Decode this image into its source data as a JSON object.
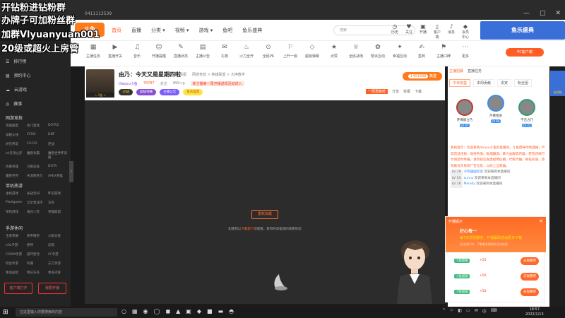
{
  "window": {
    "url": "0411113539",
    "minimize": "—",
    "maximize": "▢",
    "close": "✕"
  },
  "overlay": {
    "line1": "开钻粉进钻粉群",
    "line2": "办牌子可加粉丝群",
    "line3": "加群Vlyuanyuan001",
    "line4": "20级或超火上房管"
  },
  "nav": {
    "logo": "斗鱼",
    "items": [
      "首页",
      "直播",
      "分类 ▾",
      "视频 ▾",
      "游戏 ▾",
      "鱼吧",
      "鱼乐盛典"
    ],
    "search_placeholder": "搜索",
    "icons": [
      {
        "icon": "history-icon",
        "glyph": "◷",
        "label": "历史"
      },
      {
        "icon": "follow-icon",
        "glyph": "♥",
        "label": "关注"
      },
      {
        "icon": "broadcast-icon",
        "glyph": "▣",
        "label": "开播"
      },
      {
        "icon": "mobile-icon",
        "glyph": "▯",
        "label": "客户端"
      },
      {
        "icon": "bell-icon",
        "glyph": "♪",
        "label": "消息"
      },
      {
        "icon": "gift-icon",
        "glyph": "◆",
        "label": "会员中心"
      }
    ],
    "banner": "鱼乐盛典"
  },
  "categories": [
    {
      "glyph": "▦",
      "label": "主播任务"
    },
    {
      "glyph": "▶",
      "label": "直播开关"
    },
    {
      "glyph": "♫",
      "label": "音乐"
    },
    {
      "glyph": "☺",
      "label": "开播提醒"
    },
    {
      "glyph": "✎",
      "label": "直播状态"
    },
    {
      "glyph": "▤",
      "label": "主播公告"
    },
    {
      "glyph": "✉",
      "label": "礼物"
    },
    {
      "glyph": "♨",
      "label": "火力全开"
    },
    {
      "glyph": "⊙",
      "label": "全民PK"
    },
    {
      "glyph": "⚐",
      "label": "上升一级"
    },
    {
      "glyph": "◇",
      "label": "超级弹幕"
    },
    {
      "glyph": "★",
      "label": "点赞"
    },
    {
      "glyph": "♕",
      "label": "全民战场"
    },
    {
      "glyph": "✿",
      "label": "帮派互动"
    },
    {
      "glyph": "✦",
      "label": "幸福互动"
    },
    {
      "glyph": "✍",
      "label": "签到"
    },
    {
      "glyph": "⚑",
      "label": "主播口碑"
    },
    {
      "glyph": "⋯",
      "label": "更多"
    }
  ],
  "pc_button": "PC客户端",
  "sidebar": {
    "items": [
      {
        "glyph": "☰",
        "label": "排行榜"
      },
      {
        "glyph": "▤",
        "label": "预约中心"
      },
      {
        "glyph": "☁",
        "label": "云游戏"
      },
      {
        "glyph": "◎",
        "label": "赛事"
      }
    ],
    "section1": {
      "title": "网游竞技",
      "grid": [
        "英雄联盟",
        "热门游戏",
        "DOTA2",
        "穿越火线",
        "CFHD",
        "DNF",
        "炉石传说",
        "CS:GO",
        "逆战",
        "lol云顶之弈",
        "魔兽争霸",
        "魔兽世界怀旧服",
        "风暴英雄",
        "冷暖竞技",
        "DOTA",
        "魔兽世界",
        "天涯明月刀",
        "APEX英雄"
      ]
    },
    "section2": {
      "title": "单机热游",
      "grid": [
        "主机游戏",
        "永劫无间",
        "怀旧游戏",
        "Pixelgame",
        "艾尔登法环",
        "方舟",
        "单机游戏",
        "鬼谷八荒",
        "英雄联盟"
      ]
    },
    "section3": {
      "title": "手游休闲",
      "grid": [
        "王者荣耀",
        "和平精英",
        "火影忍者",
        "LOL手游",
        "原神",
        "幻塔",
        "CODM手游",
        "崩坏星穹",
        "CF手游",
        "综合手游",
        "鸣潮",
        "天刀手游",
        "休闲益智",
        "明日方舟",
        "更多内容"
      ]
    },
    "btn1": "客户端打开",
    "btn2": "我要开播"
  },
  "room": {
    "title": "由乃：今天又是星期四啦",
    "tags": [
      "情报",
      "网游竞技 > 英雄联盟 > 大神教学"
    ],
    "avatar_badge": "☆ 1金 ☆",
    "pills": [
      {
        "text": "10级",
        "bg": "#333",
        "fg": "#ffd200"
      },
      {
        "text": "超级弹幕",
        "bg": "#8a4bd6",
        "fg": "#fff"
      },
      {
        "text": "主播公告",
        "bg": "#7a5cff",
        "fg": "#fff"
      },
      {
        "text": "鱼乐盛典",
        "bg": "#ffe14a",
        "fg": "#b36b00"
      }
    ],
    "subinfo": [
      "lifaoyu小鱼",
      "78787",
      "关注",
      "999+g"
    ],
    "promo": "新主播第一周开播返现活动进入",
    "follow_count": "1401888",
    "follow_label": "关注",
    "actions": [
      "分享",
      "举报",
      "下载"
    ],
    "contribution": "一周贡献榜"
  },
  "player": {
    "retry": "重新加载",
    "msg_prefix": "如遇到以",
    "msg_link": "下载客户端",
    "msg_suffix": "观看，获得纯净极速的观看体验"
  },
  "right": {
    "tabs": [
      "主播招募",
      "直播任务"
    ],
    "subtabs": [
      "今日收益",
      "本周贡献",
      "贵宾",
      "粉丝团"
    ],
    "ranks": [
      {
        "name": "开保留占乃",
        "lv": "LV 47",
        "color": "#c0392b"
      },
      {
        "name": "乃佛哈多",
        "lv": "LV 64",
        "color": "#3d8ef2"
      },
      {
        "name": "千吉占乃",
        "lv": "LV 22",
        "color": "#2e9e6e"
      }
    ],
    "chat": [
      {
        "type": "sys",
        "text": "系统提示：欢迎来到douyu斗鱼的直播间。斗鱼倡导绿色直播，严禁违法违规、低俗色情、吸烟酗酒、暴力血腥等内容，若有违规行为请及时举报。请勿轻信各类招聘征婚、代练代抽、刷钻充值、游戏账号交易等广告信息，以防上当受骗。"
      },
      {
        "type": "msg",
        "lv": "LV 19",
        "name": "冷风幽幽欢迎",
        "text": "欢迎来到本直播间"
      },
      {
        "type": "msg",
        "lv": "LV 20",
        "name": "Lunny",
        "text": "欢迎来到本直播间"
      },
      {
        "type": "msg",
        "lv": "LV 16",
        "name": "Melody",
        "text": "欢迎来到本直播间"
      }
    ],
    "popup": {
      "title": "开播提示",
      "heading": "好心每一",
      "subtitle": "每7天经验翻倍，开播赢取活动更多下载",
      "detail": "活动进行中，了解更多规则及活动信息",
      "close": "✕",
      "tasks": [
        {
          "tag": "小鱼超级",
          "val": "+25",
          "btn": "去观看吧"
        },
        {
          "tag": "小鱼超级",
          "val": "+50",
          "btn": "去观看吧"
        },
        {
          "tag": "小鱼超级",
          "val": "+50",
          "btn": "去观看吧"
        }
      ]
    },
    "side_badge": "去领取"
  },
  "taskbar": {
    "search": "在这里输入你要搜索的内容",
    "time": "18:57",
    "date": "2022/1/13",
    "apps": [
      "○",
      "▦",
      "◉",
      "◯",
      "◼",
      "▲",
      "▣",
      "◆",
      "■",
      "▬",
      "◓"
    ],
    "tray": [
      "^",
      "⚐",
      "◧",
      "▭",
      "✉",
      "中",
      "⌨"
    ]
  }
}
